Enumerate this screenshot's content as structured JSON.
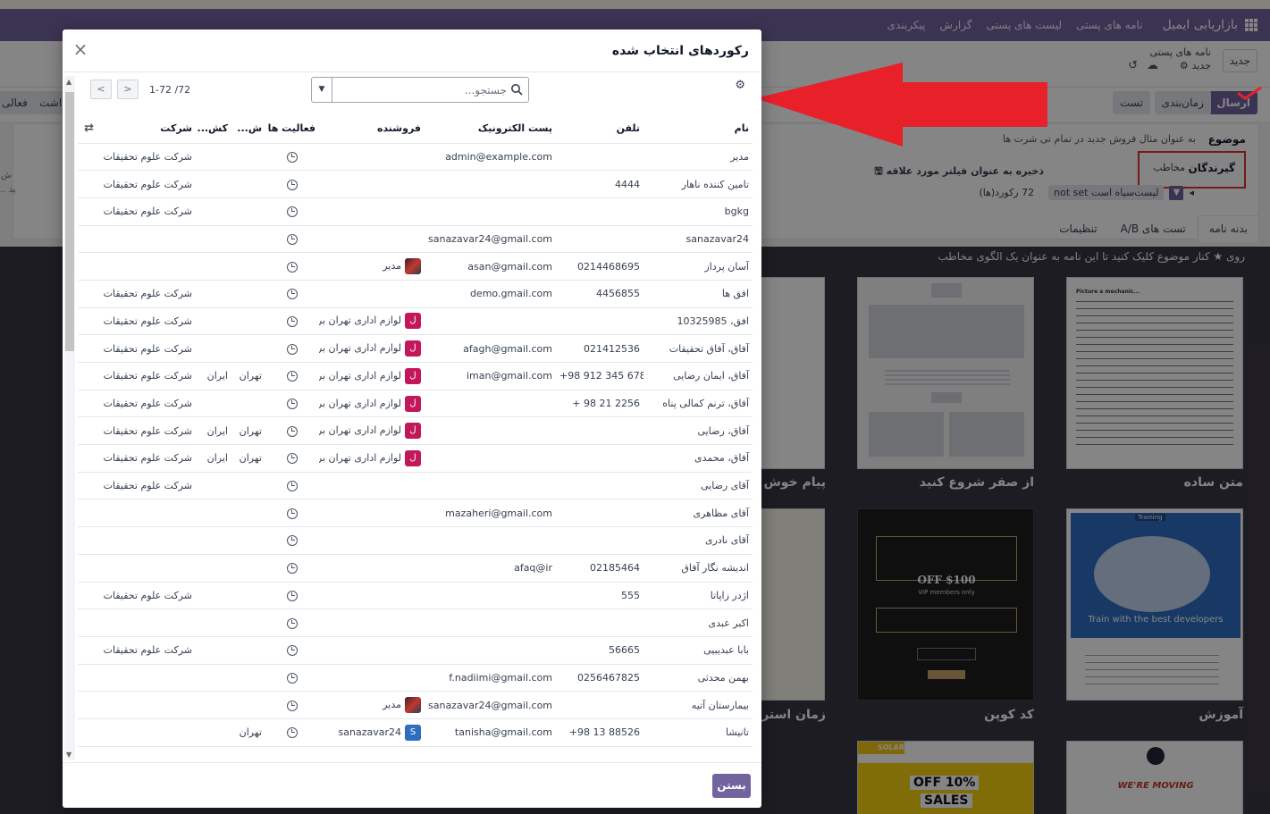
{
  "navbar": {
    "app_name": "بازاریابی ایمیل",
    "items": [
      "نامه های پستی",
      "لیست های پستی",
      "گزارش",
      "پیکربندی"
    ]
  },
  "control": {
    "new_label": "جدید",
    "breadcrumb_parent": "نامه های پستی",
    "breadcrumb_current": "جدید"
  },
  "status_buttons": {
    "send": "ارسال",
    "schedule": "زمان‌بندی",
    "test": "تست",
    "left_cut_1": "فعالی",
    "left_cut_2": "داشت"
  },
  "form": {
    "subject_label": "موضوع",
    "subject_placeholder": "به عنوان مثال فروش جدید در تمام تی شرت ها",
    "recipients_label": "گیرندگان",
    "recipients_value": "مخاطب",
    "save_filter": "ذخیره به عنوان فیلتر مورد علاقه",
    "filter_chip": "لیست‌سیاه است not set",
    "records_count": "72 رکورد(ها)",
    "side_cut_1": "ش",
    "side_cut_2": "ید ..."
  },
  "tabs": [
    "بدنه نامه",
    "تست های A/B",
    "تنظیمات"
  ],
  "gallery": {
    "hint": "روی ★ کنار موضوع کلیک کنید تا این نامه به عنوان یک الگوی مخاطب",
    "templates": [
      {
        "title": "متن ساده"
      },
      {
        "title": "از صفر شروع کنید"
      },
      {
        "title": "پیام خوش آم"
      },
      {
        "title": "آموزش"
      },
      {
        "title": "کد کوپن"
      },
      {
        "title": "زمان استراحت"
      }
    ],
    "thumb_texts": {
      "training_badge": "Training",
      "training_caption": "Train with the best developers",
      "coupon_off": "$100 OFF",
      "coupon_vip": "VIP members only",
      "solar": "SOLAR",
      "sales": "10% OFF",
      "sales2": "SALES",
      "moving": "WE'RE MOVING",
      "plain_heading": "Picture a mechanic..."
    }
  },
  "dialog": {
    "title": "رکوردهای انتخاب شده",
    "search_placeholder": "جستجو...",
    "pager": "1-72 /72",
    "close_button": "بستن",
    "columns": [
      "نام",
      "تلفن",
      "پست الکترونیک",
      "فروشنده",
      "فعالیت ها",
      "ش...",
      "کش...",
      "شرکت"
    ],
    "rows": [
      {
        "name": "مدیر",
        "phone": "",
        "email": "admin@example.com",
        "seller": "",
        "seller_avatar": "",
        "state": "",
        "country": "",
        "company": "شرکت علوم تحقیقات"
      },
      {
        "name": "تامین کننده ناهار",
        "phone": "4444",
        "email": "",
        "seller": "",
        "seller_avatar": "",
        "state": "",
        "country": "",
        "company": "شرکت علوم تحقیقات"
      },
      {
        "name": "bgkg",
        "phone": "",
        "email": "",
        "seller": "",
        "seller_avatar": "",
        "state": "",
        "country": "",
        "company": "شرکت علوم تحقیقات"
      },
      {
        "name": "sanazavar24",
        "phone": "",
        "email": "sanazavar24@gmail.com",
        "seller": "",
        "seller_avatar": "",
        "state": "",
        "country": "",
        "company": ""
      },
      {
        "name": "آسان پرداز",
        "phone": "0214468695",
        "email": "asan@gmail.com",
        "seller": "مدیر",
        "seller_avatar": "photo",
        "state": "",
        "country": "",
        "company": ""
      },
      {
        "name": "افق ها",
        "phone": "4456855",
        "email": "demo.gmail.com",
        "seller": "",
        "seller_avatar": "",
        "state": "",
        "country": "",
        "company": "شرکت علوم تحقیقات"
      },
      {
        "name": "افق، 10325985",
        "phone": "",
        "email": "",
        "seller": "لوازم اداری تهران برتر",
        "seller_avatar": "red",
        "state": "",
        "country": "",
        "company": "شرکت علوم تحقیقات"
      },
      {
        "name": "آفاق، آفاق تحقیقات",
        "phone": "021412536",
        "email": "afagh@gmail.com",
        "seller": "لوازم اداری تهران برتر",
        "seller_avatar": "red",
        "state": "",
        "country": "",
        "company": "شرکت علوم تحقیقات"
      },
      {
        "name": "آفاق، ایمان رضایی",
        "phone": "+98 912 345 6789",
        "email": "iman@gmail.com",
        "seller": "لوازم اداری تهران برتر",
        "seller_avatar": "red",
        "state": "تهران",
        "country": "ایران",
        "company": "شرکت علوم تحقیقات"
      },
      {
        "name": "آفاق، ترنم کمالی پناه",
        "phone": "+ 98 21 2256",
        "email": "",
        "seller": "لوازم اداری تهران برتر",
        "seller_avatar": "red",
        "state": "",
        "country": "",
        "company": "شرکت علوم تحقیقات"
      },
      {
        "name": "آفاق، رضایی",
        "phone": "",
        "email": "",
        "seller": "لوازم اداری تهران برتر",
        "seller_avatar": "red",
        "state": "تهران",
        "country": "ایران",
        "company": "شرکت علوم تحقیقات"
      },
      {
        "name": "آفاق، محمدی",
        "phone": "",
        "email": "",
        "seller": "لوازم اداری تهران برتر",
        "seller_avatar": "red",
        "state": "تهران",
        "country": "ایران",
        "company": "شرکت علوم تحقیقات"
      },
      {
        "name": "آقای رضایی",
        "phone": "",
        "email": "",
        "seller": "",
        "seller_avatar": "",
        "state": "",
        "country": "",
        "company": "شرکت علوم تحقیقات"
      },
      {
        "name": "آقای مظاهری",
        "phone": "",
        "email": "mazaheri@gmail.com",
        "seller": "",
        "seller_avatar": "",
        "state": "",
        "country": "",
        "company": ""
      },
      {
        "name": "آقای نادری",
        "phone": "",
        "email": "",
        "seller": "",
        "seller_avatar": "",
        "state": "",
        "country": "",
        "company": ""
      },
      {
        "name": "اندیشه نگار آفاق",
        "phone": "02185464",
        "email": "afaq@ir",
        "seller": "",
        "seller_avatar": "",
        "state": "",
        "country": "",
        "company": ""
      },
      {
        "name": "اژدر زاپاتا",
        "phone": "555",
        "email": "",
        "seller": "",
        "seller_avatar": "",
        "state": "",
        "country": "",
        "company": "شرکت علوم تحقیقات"
      },
      {
        "name": "اکبر عبدی",
        "phone": "",
        "email": "",
        "seller": "",
        "seller_avatar": "",
        "state": "",
        "country": "",
        "company": ""
      },
      {
        "name": "بابا عبدیبیی",
        "phone": "56665",
        "email": "",
        "seller": "",
        "seller_avatar": "",
        "state": "",
        "country": "",
        "company": "شرکت علوم تحقیقات"
      },
      {
        "name": "بهمن محدثی",
        "phone": "0256467825",
        "email": "f.nadiimi@gmail.com",
        "seller": "",
        "seller_avatar": "",
        "state": "",
        "country": "",
        "company": ""
      },
      {
        "name": "بیمارستان آتیه",
        "phone": "",
        "email": "sanazavar24@gmail.com",
        "seller": "مدیر",
        "seller_avatar": "photo",
        "state": "",
        "country": "",
        "company": ""
      },
      {
        "name": "تانیشا",
        "phone": "+98 13 88526",
        "email": "tanisha@gmail.com",
        "seller": "sanazavar24",
        "seller_avatar": "blue",
        "state": "تهران",
        "country": "",
        "company": ""
      }
    ],
    "avatar_letters": {
      "red": "ل",
      "blue": "S",
      "photo": ""
    }
  },
  "colors": {
    "brand": "#71639e",
    "annotation_red": "#e8202a"
  }
}
